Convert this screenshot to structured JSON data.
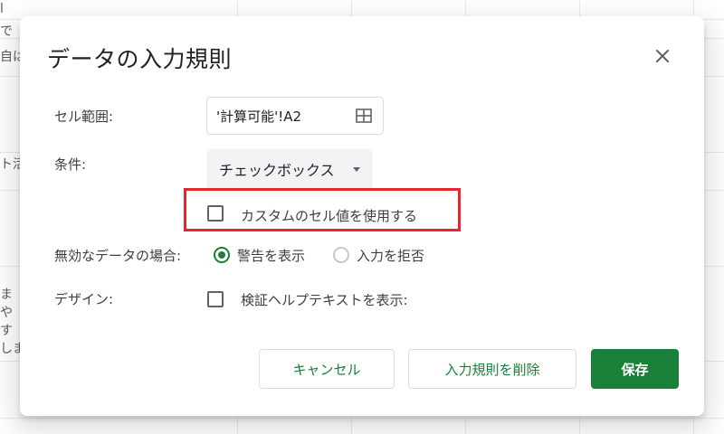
{
  "background_sheet": {
    "left_fragments": [
      "l",
      "で",
      "自は",
      "ト活",
      "ま",
      "や",
      "す",
      "しま"
    ]
  },
  "dialog": {
    "title": "データの入力規則",
    "close_icon": "close-icon",
    "cell_range": {
      "label": "セル範囲:",
      "value": "'計算可能'!A2",
      "icon": "grid-select-icon"
    },
    "criteria": {
      "label": "条件:",
      "selected": "チェックボックス"
    },
    "custom_values": {
      "label": "カスタムのセル値を使用する",
      "checked": false
    },
    "invalid_data": {
      "label": "無効なデータの場合:",
      "options": [
        {
          "label": "警告を表示",
          "selected": true
        },
        {
          "label": "入力を拒否",
          "selected": false
        }
      ]
    },
    "appearance": {
      "label": "デザイン:",
      "help_text_label": "検証ヘルプテキストを表示:",
      "checked": false
    },
    "buttons": {
      "cancel": "キャンセル",
      "remove": "入力規則を削除",
      "save": "保存"
    }
  },
  "colors": {
    "primary_green": "#188038",
    "highlight_red": "#e8262d"
  }
}
